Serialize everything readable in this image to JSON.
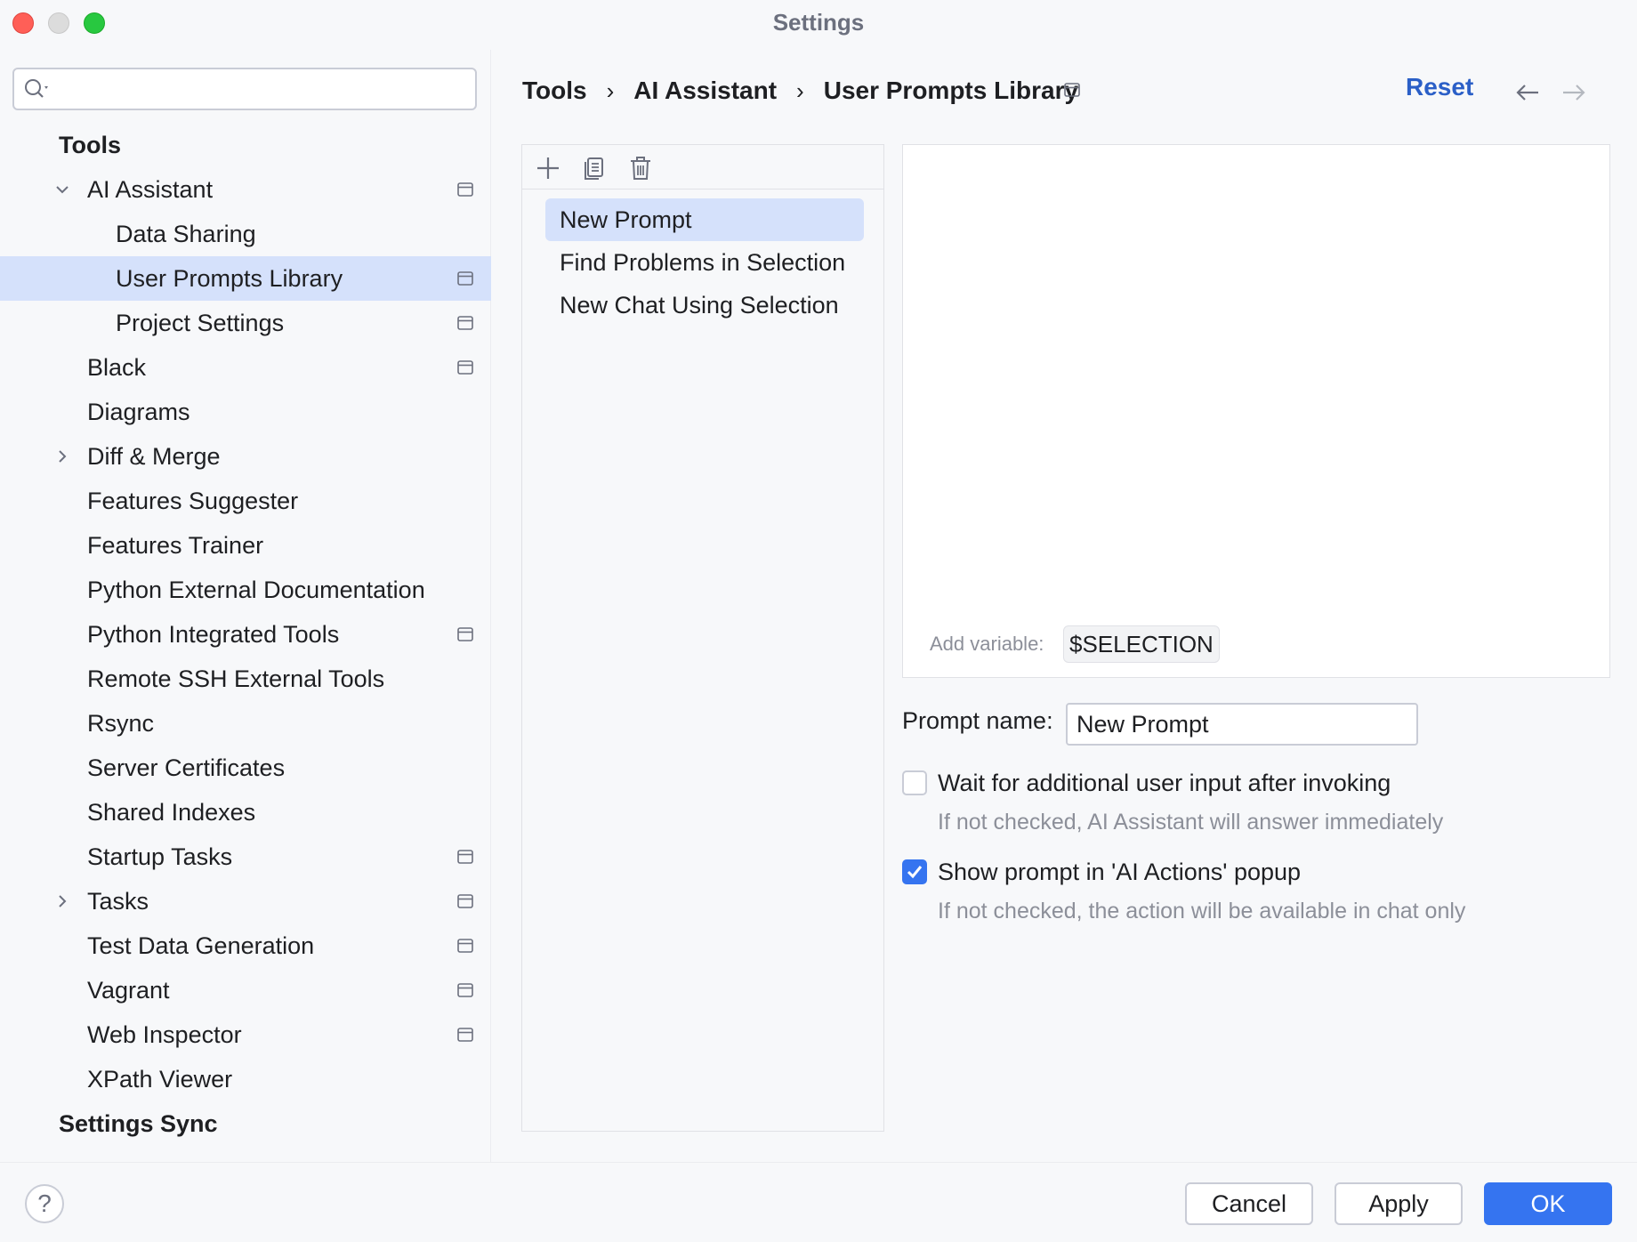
{
  "window": {
    "title": "Settings"
  },
  "search": {
    "placeholder": "",
    "value": ""
  },
  "sidebar": {
    "items": [
      {
        "label": "Tools"
      },
      {
        "label": "AI Assistant"
      },
      {
        "label": "Data Sharing"
      },
      {
        "label": "User Prompts Library"
      },
      {
        "label": "Project Settings"
      },
      {
        "label": "Black"
      },
      {
        "label": "Diagrams"
      },
      {
        "label": "Diff & Merge"
      },
      {
        "label": "Features Suggester"
      },
      {
        "label": "Features Trainer"
      },
      {
        "label": "Python External Documentation"
      },
      {
        "label": "Python Integrated Tools"
      },
      {
        "label": "Remote SSH External Tools"
      },
      {
        "label": "Rsync"
      },
      {
        "label": "Server Certificates"
      },
      {
        "label": "Shared Indexes"
      },
      {
        "label": "Startup Tasks"
      },
      {
        "label": "Tasks"
      },
      {
        "label": "Test Data Generation"
      },
      {
        "label": "Vagrant"
      },
      {
        "label": "Web Inspector"
      },
      {
        "label": "XPath Viewer"
      },
      {
        "label": "Settings Sync"
      }
    ]
  },
  "breadcrumb": {
    "items": [
      "Tools",
      "AI Assistant",
      "User Prompts Library"
    ],
    "separator": "›"
  },
  "header": {
    "reset_label": "Reset"
  },
  "prompts": {
    "items": [
      "New Prompt",
      "Find Problems in Selection",
      "New Chat Using Selection"
    ]
  },
  "editor": {
    "content": "",
    "add_variable_label": "Add variable:",
    "variable": "$SELECTION"
  },
  "form": {
    "name_label": "Prompt name:",
    "name_value": "New Prompt",
    "wait_label": "Wait for additional user input after invoking",
    "wait_hint": "If not checked, AI Assistant will answer immediately",
    "wait_checked": false,
    "show_label": "Show prompt in 'AI Actions' popup",
    "show_hint": "If not checked, the action will be available in chat only",
    "show_checked": true
  },
  "footer": {
    "help_label": "?",
    "cancel_label": "Cancel",
    "apply_label": "Apply",
    "ok_label": "OK"
  },
  "colors": {
    "accent": "#3574f0",
    "link": "#2b5fc7",
    "selection": "#d5e1fb"
  }
}
